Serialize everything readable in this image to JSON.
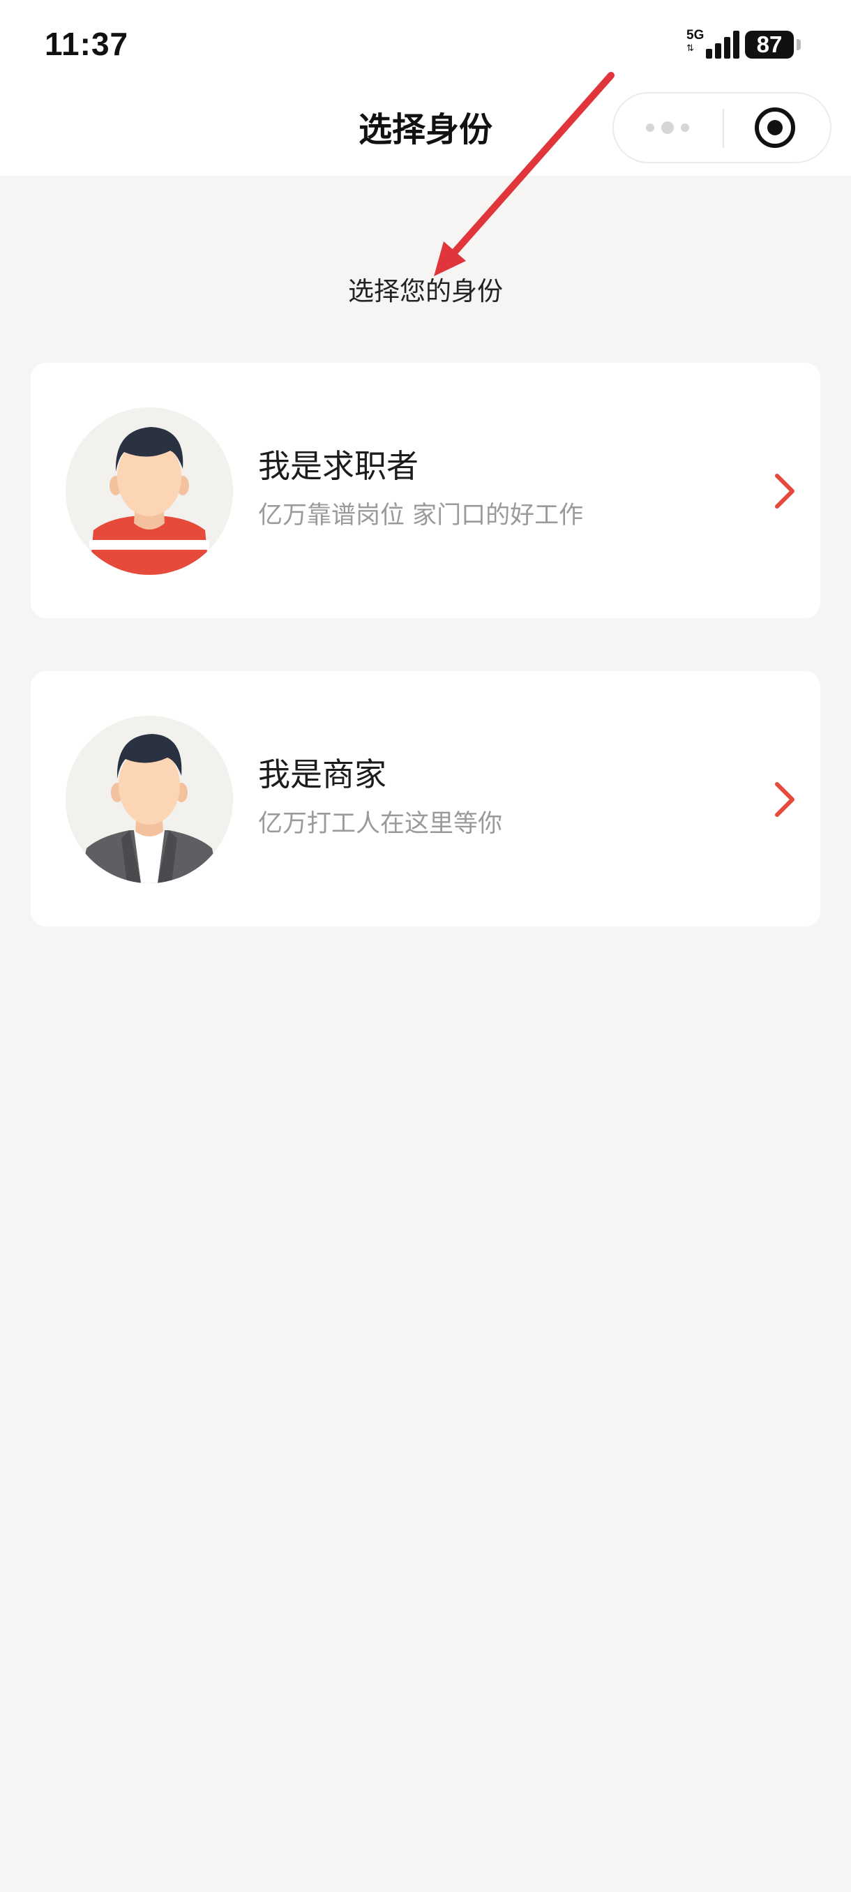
{
  "status_bar": {
    "time": "11:37",
    "network": "5G",
    "network_arrows": "⇅",
    "battery": "87"
  },
  "nav": {
    "title": "选择身份",
    "capsule_more_icon": "more-dots-icon",
    "capsule_close_icon": "target-icon"
  },
  "main": {
    "subtitle": "选择您的身份",
    "cards": [
      {
        "title": "我是求职者",
        "desc": "亿万靠谱岗位 家门口的好工作",
        "avatar_icon": "job-seeker-avatar",
        "arrow_icon": "chevron-right-icon"
      },
      {
        "title": "我是商家",
        "desc": "亿万打工人在这里等你",
        "avatar_icon": "merchant-avatar",
        "arrow_icon": "chevron-right-icon"
      }
    ]
  },
  "colors": {
    "accent": "#e64a3b",
    "annotation_arrow": "#e0353b",
    "background": "#f6f5f3",
    "card": "#ffffff",
    "title_text": "#1c1c1c",
    "desc_text": "#9a9a9a"
  }
}
